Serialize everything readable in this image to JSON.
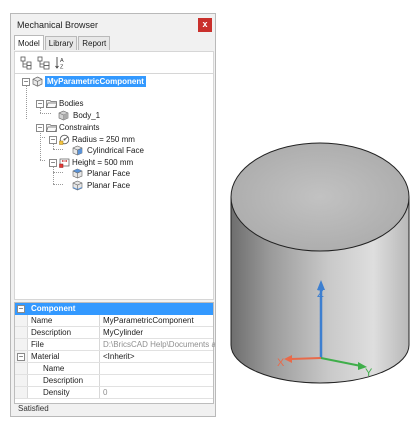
{
  "window": {
    "title": "Mechanical Browser",
    "close_glyph": "x"
  },
  "tabs": [
    {
      "label": "Model",
      "active": true
    },
    {
      "label": "Library",
      "active": false
    },
    {
      "label": "Report",
      "active": false
    }
  ],
  "toolbar": {
    "icons": [
      "browse-tree-icon",
      "browse-tree-alt-icon",
      "sort-az-icon"
    ]
  },
  "tree": {
    "root": {
      "label": "MyParametricComponent",
      "expanded": true,
      "selected": true
    },
    "bodies": {
      "label": "Bodies",
      "expanded": true
    },
    "body_1": {
      "label": "Body_1"
    },
    "constraints": {
      "label": "Constraints",
      "expanded": true
    },
    "radius": {
      "label": "Radius = 250 mm",
      "expanded": true
    },
    "cyl_face": {
      "label": "Cylindrical Face"
    },
    "height": {
      "label": "Height = 500 mm",
      "expanded": true
    },
    "planar_face_1": {
      "label": "Planar Face"
    },
    "planar_face_2": {
      "label": "Planar Face"
    }
  },
  "properties": {
    "category": "Component",
    "name": {
      "label": "Name",
      "value": "MyParametricComponent"
    },
    "description": {
      "label": "Description",
      "value": "MyCylinder"
    },
    "file": {
      "label": "File",
      "value": "D:\\BricsCAD Help\\Documents and Dr..."
    },
    "material": {
      "label": "Material",
      "value": "<Inherit>"
    },
    "mat_name": {
      "label": "Name",
      "value": ""
    },
    "mat_description": {
      "label": "Description",
      "value": ""
    },
    "mat_density": {
      "label": "Density",
      "value": "0"
    }
  },
  "status": {
    "text": "Satisfied"
  },
  "viewport": {
    "axes": {
      "z": "Z",
      "y": "Y",
      "x": "X"
    },
    "colors": {
      "z_axis": "#3d7fd0",
      "y_axis": "#3fae4a",
      "x_axis": "#e86a4a",
      "selection": "#3399ff"
    }
  }
}
